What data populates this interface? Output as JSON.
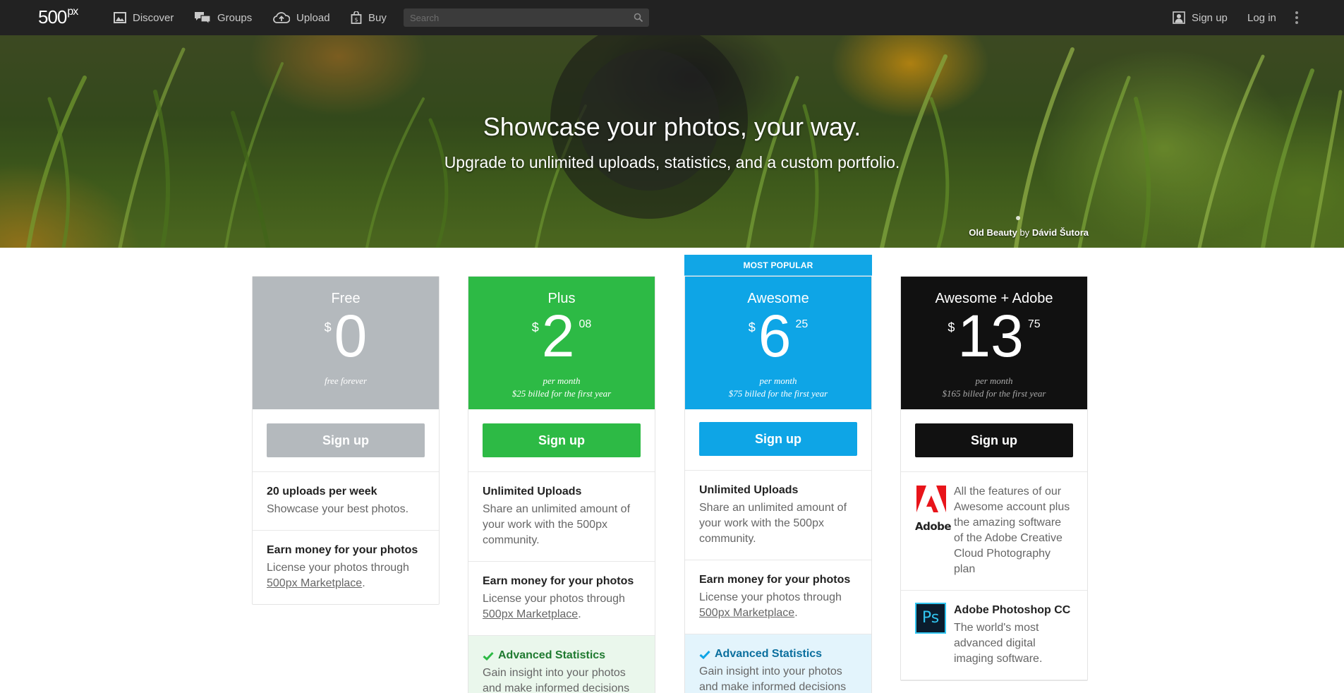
{
  "nav": {
    "logo": "500",
    "logo_sup": "px",
    "discover": "Discover",
    "groups": "Groups",
    "upload": "Upload",
    "buy": "Buy",
    "search_placeholder": "Search",
    "signup": "Sign up",
    "login": "Log in"
  },
  "hero": {
    "title": "Showcase your photos, your way.",
    "subtitle": "Upgrade to unlimited uploads, statistics, and a custom portfolio.",
    "credit_title": "Old Beauty",
    "credit_by": "by",
    "credit_author": "Dávid Šutora"
  },
  "colors": {
    "free": "#b4b9bd",
    "plus": "#2dba45",
    "awesome": "#0ea5e6",
    "adobe": "#111111",
    "nav_bg": "#222222"
  },
  "plans": {
    "free": {
      "name": "Free",
      "currency": "$",
      "amount": "0",
      "cents": "",
      "period": "free forever",
      "billed": "",
      "button": "Sign up",
      "f1_title": "20 uploads per week",
      "f1_desc": "Showcase your best photos.",
      "f2_title": "Earn money for your photos",
      "f2_desc": "License your photos through",
      "f2_link": "500px Marketplace",
      "f2_end": "."
    },
    "plus": {
      "name": "Plus",
      "currency": "$",
      "amount": "2",
      "cents": "08",
      "period": "per month",
      "billed": "$25 billed for the first year",
      "button": "Sign up",
      "f1_title": "Unlimited Uploads",
      "f1_desc": "Share an unlimited amount of your work with the 500px community.",
      "f2_title": "Earn money for your photos",
      "f2_desc": "License your photos through",
      "f2_link": "500px Marketplace",
      "f2_end": ".",
      "f3_title": "Advanced Statistics",
      "f3_desc": "Gain insight into your photos and make informed decisions"
    },
    "awesome": {
      "badge": "MOST POPULAR",
      "name": "Awesome",
      "currency": "$",
      "amount": "6",
      "cents": "25",
      "period": "per month",
      "billed": "$75 billed for the first year",
      "button": "Sign up",
      "f1_title": "Unlimited Uploads",
      "f1_desc": "Share an unlimited amount of your work with the 500px community.",
      "f2_title": "Earn money for your photos",
      "f2_desc": "License your photos through",
      "f2_link": "500px Marketplace",
      "f2_end": ".",
      "f3_title": "Advanced Statistics",
      "f3_desc": "Gain insight into your photos and make informed decisions"
    },
    "adobe": {
      "name": "Awesome + Adobe",
      "currency": "$",
      "amount": "13",
      "cents": "75",
      "period": "per month",
      "billed": "$165 billed for the first year",
      "button": "Sign up",
      "logo_text": "Adobe",
      "f1_desc": "All the features of our Awesome account plus the amazing software of the Adobe Creative Cloud Photography plan",
      "ps_label": "Ps",
      "f2_title": "Adobe Photoshop CC",
      "f2_desc": "The world's most advanced digital imaging software."
    }
  }
}
